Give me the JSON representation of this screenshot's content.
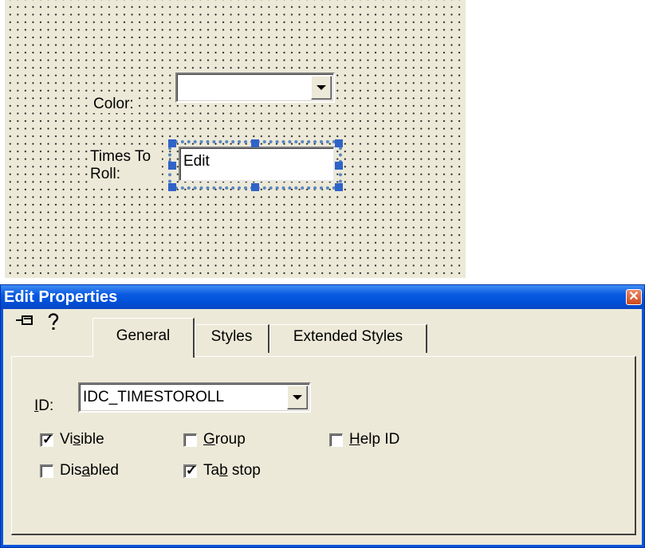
{
  "canvas": {
    "color_label": "Color:",
    "times_label_line1": "Times To",
    "times_label_line2": "Roll:",
    "edit_text": "Edit"
  },
  "props_window": {
    "title": "Edit Properties",
    "close_glyph": "✕",
    "tabs": [
      {
        "label": "General",
        "selected": true
      },
      {
        "label": "Styles",
        "selected": false
      },
      {
        "label": "Extended Styles",
        "selected": false
      }
    ],
    "id_field": {
      "label_underlined": "I",
      "label_rest": "D:",
      "value": "IDC_TIMESTOROLL"
    },
    "checkboxes": {
      "visible": {
        "pre": "Vi",
        "key": "s",
        "post": "ible",
        "checked": true
      },
      "group": {
        "pre": "",
        "key": "G",
        "post": "roup",
        "checked": false
      },
      "help_id": {
        "pre": "",
        "key": "H",
        "post": "elp ID",
        "checked": false
      },
      "disabled": {
        "pre": "Dis",
        "key": "a",
        "post": "bled",
        "checked": false
      },
      "tab_stop": {
        "pre": "Ta",
        "key": "b",
        "post": " stop",
        "checked": true
      }
    },
    "check_glyph": "✓",
    "icons": [
      "pin-icon",
      "help-icon"
    ]
  },
  "colors": {
    "dialog_face": "#ECE9D8",
    "titlebar_blue": "#0a5ae2",
    "selection_handle": "#2f63c8"
  }
}
